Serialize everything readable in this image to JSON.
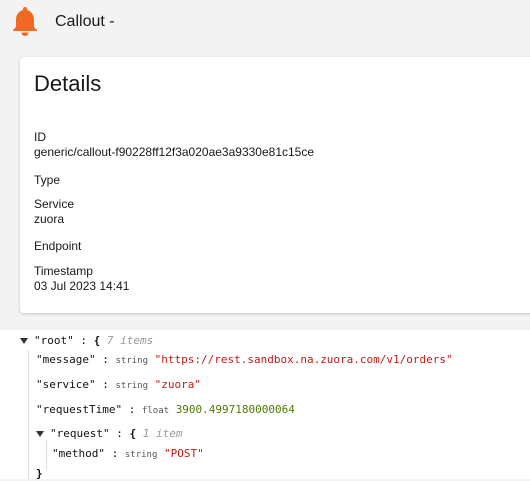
{
  "header": {
    "title": "Callout -"
  },
  "details": {
    "title": "Details",
    "fields": [
      {
        "label": "ID",
        "value": "generic/callout-f90228ff12f3a020ae3a9330e81c15ce"
      },
      {
        "label": "Type",
        "value": ""
      },
      {
        "label": "Service",
        "value": "zuora"
      },
      {
        "label": "Endpoint",
        "value": ""
      },
      {
        "label": "Timestamp",
        "value": "03 Jul 2023 14:41"
      }
    ]
  },
  "json": {
    "root_key": "\"root\"",
    "root_count": "7 items",
    "message_key": "\"message\"",
    "message_type": "string",
    "message_value": "\"https://rest.sandbox.na.zuora.com/v1/orders\"",
    "service_key": "\"service\"",
    "service_type": "string",
    "service_value": "\"zuora\"",
    "requestTime_key": "\"requestTime\"",
    "requestTime_type": "float",
    "requestTime_value": "3900.4997180000064",
    "request_key": "\"request\"",
    "request_count": "1 item",
    "method_key": "\"method\"",
    "method_type": "string",
    "method_value": "\"POST\"",
    "colon": ":",
    "open_brace": "{",
    "close_brace": "}"
  },
  "colors": {
    "bell": "#f06a24"
  }
}
